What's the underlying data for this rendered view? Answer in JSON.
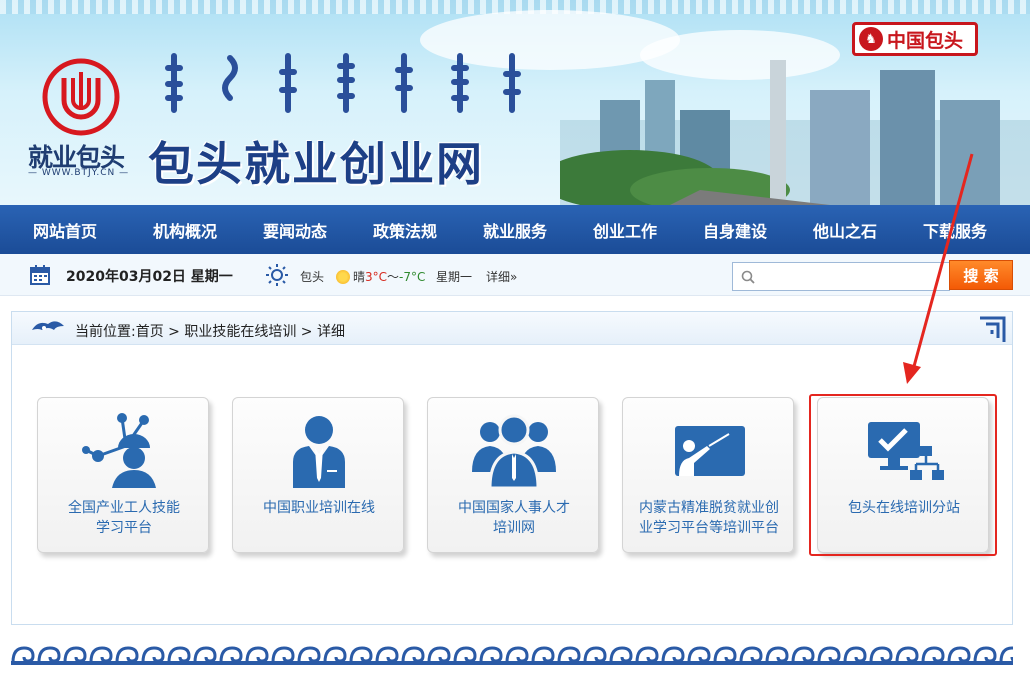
{
  "header": {
    "logo_text": "就业包头",
    "logo_url": "— WWW.BTJY.CN —",
    "site_title": "包头就业创业网",
    "badge_text": "中国包头"
  },
  "nav": {
    "items": [
      "网站首页",
      "机构概况",
      "要闻动态",
      "政策法规",
      "就业服务",
      "创业工作",
      "自身建设",
      "他山之石",
      "下载服务"
    ]
  },
  "infobar": {
    "date": "2020年03月02日 星期一",
    "city": "包头",
    "weather_desc": "晴",
    "temp_high": "3°C",
    "temp_sep": "～",
    "temp_low": "-7°C",
    "weekday": "星期一",
    "detail": "详细»"
  },
  "search": {
    "placeholder": "",
    "button": "搜 索"
  },
  "breadcrumb": {
    "text": "当前位置:首页 > 职业技能在线培训 > 详细"
  },
  "cards": [
    {
      "line1": "全国产业工人技能",
      "line2": "学习平台",
      "icon": "worker-network-icon"
    },
    {
      "line1": "中国职业培训在线",
      "line2": "",
      "icon": "businessman-icon"
    },
    {
      "line1": "中国国家人事人才",
      "line2": "培训网",
      "icon": "team-people-icon"
    },
    {
      "line1": "内蒙古精准脱贫就业创",
      "line2": "业学习平台等培训平台",
      "icon": "teaching-board-icon"
    },
    {
      "line1": "包头在线培训分站",
      "line2": "",
      "icon": "monitor-check-network-icon"
    }
  ],
  "colors": {
    "nav_bg": "#1b4c97",
    "accent_red": "#e4261f",
    "card_text": "#2a6ab0",
    "search_btn": "#f35a06"
  }
}
